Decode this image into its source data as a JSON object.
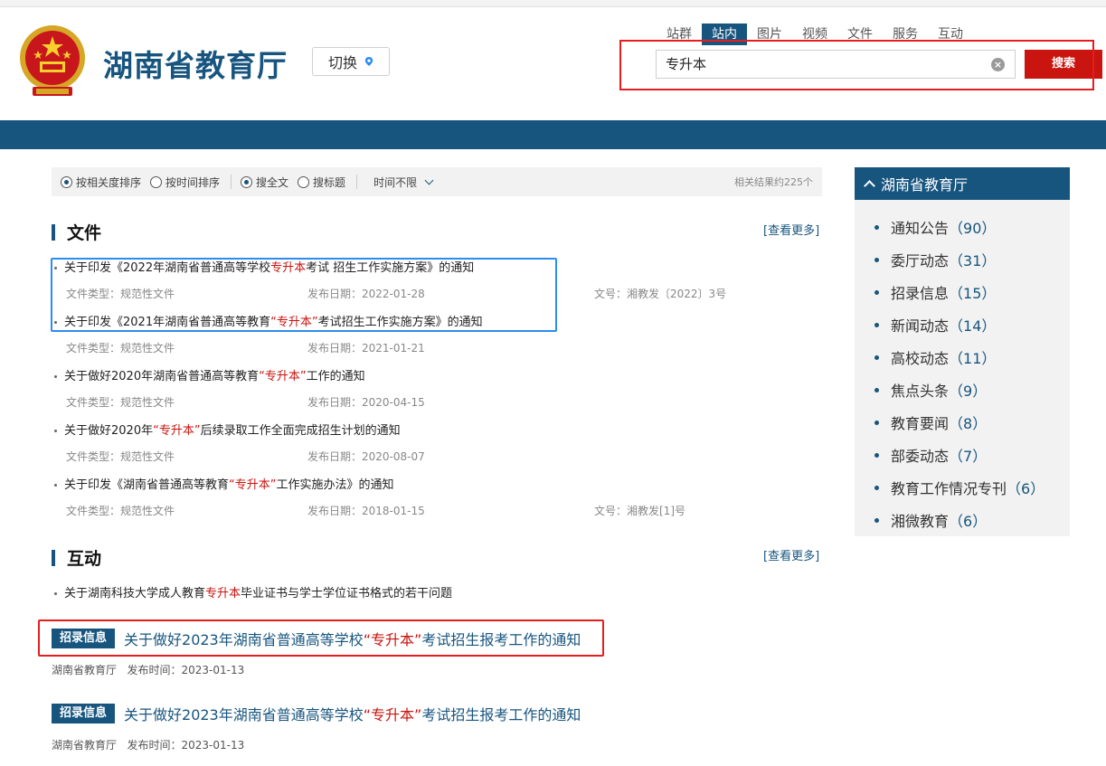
{
  "header": {
    "site_title": "湖南省教育厅",
    "switch_label": "切换",
    "scope_tabs": [
      {
        "label": "站群",
        "active": false
      },
      {
        "label": "站内",
        "active": true
      },
      {
        "label": "图片",
        "active": false
      },
      {
        "label": "视频",
        "active": false
      },
      {
        "label": "文件",
        "active": false
      },
      {
        "label": "服务",
        "active": false
      },
      {
        "label": "互动",
        "active": false
      }
    ],
    "search_value": "专升本",
    "search_button": "搜索"
  },
  "filters": {
    "sort_relevance": "按相关度排序",
    "sort_time": "按时间排序",
    "search_full": "搜全文",
    "search_title": "搜标题",
    "time_range": "时间不限",
    "result_count": "相关结果约225个"
  },
  "files_section": {
    "title": "文件",
    "more": "[查看更多]",
    "items": [
      {
        "pre": "关于印发《2022年湖南省普通高等学校",
        "hl": "专升本",
        "post": "考试 招生工作实施方案》的通知",
        "type": "文件类型：规范性文件",
        "date": "发布日期：2022-01-28",
        "doc_no": "文号：湘教发〔2022〕3号"
      },
      {
        "pre": "关于印发《2021年湖南省普通高等教育",
        "hl": "“专升本”",
        "post": "考试招生工作实施方案》的通知",
        "type": "文件类型：规范性文件",
        "date": "发布日期：2021-01-21",
        "doc_no": ""
      },
      {
        "pre": "关于做好2020年湖南省普通高等教育",
        "hl": "“专升本”",
        "post": "工作的通知",
        "type": "文件类型：规范性文件",
        "date": "发布日期：2020-04-15",
        "doc_no": ""
      },
      {
        "pre": "关于做好2020年",
        "hl": "“专升本”",
        "post": "后续录取工作全面完成招生计划的通知",
        "type": "文件类型：规范性文件",
        "date": "发布日期：2020-08-07",
        "doc_no": ""
      },
      {
        "pre": "关于印发《湖南省普通高等教育",
        "hl": "“专升本”",
        "post": "工作实施办法》的通知",
        "type": "文件类型：规范性文件",
        "date": "发布日期：2018-01-15",
        "doc_no": "文号：湘教发[1]号"
      }
    ]
  },
  "interaction_section": {
    "title": "互动",
    "more": "[查看更多]",
    "items": [
      {
        "pre": "关于湖南科技大学成人教育",
        "hl": "专升本",
        "post": "毕业证书与学士学位证书格式的若干问题"
      }
    ]
  },
  "news": [
    {
      "tag": "招录信息",
      "pre": "关于做好2023年湖南省普通高等学校",
      "hl": "“专升本”",
      "post": "考试招生报考工作的通知",
      "source": "湖南省教育厅",
      "time": "发布时间：2023-01-13"
    },
    {
      "tag": "招录信息",
      "pre": "关于做好2023年湖南省普通高等学校",
      "hl": "“专升本”",
      "post": "考试招生报考工作的通知",
      "source": "湖南省教育厅",
      "time": "发布时间：2023-01-13"
    }
  ],
  "sidebar": {
    "title": "湖南省教育厅",
    "items": [
      {
        "label": "通知公告",
        "count": "（90）"
      },
      {
        "label": "委厅动态",
        "count": "（31）"
      },
      {
        "label": "招录信息",
        "count": "（15）"
      },
      {
        "label": "新闻动态",
        "count": "（14）"
      },
      {
        "label": "高校动态",
        "count": "（11）"
      },
      {
        "label": "焦点头条",
        "count": "（9）"
      },
      {
        "label": "教育要闻",
        "count": "（8）"
      },
      {
        "label": "部委动态",
        "count": "（7）"
      },
      {
        "label": "教育工作情况专刊",
        "count": "（6）"
      },
      {
        "label": "湘微教育",
        "count": "（6）"
      }
    ]
  },
  "colors": {
    "brand": "#17557f",
    "highlight": "#c9140f",
    "search_btn": "#c9140f",
    "annot_red": "#e41e1e",
    "annot_blue": "#2d8cf0"
  },
  "icons": {
    "emblem": "national-emblem-icon",
    "pin": "location-pin-icon",
    "clear": "clear-icon",
    "chevron": "chevron-down-icon"
  }
}
